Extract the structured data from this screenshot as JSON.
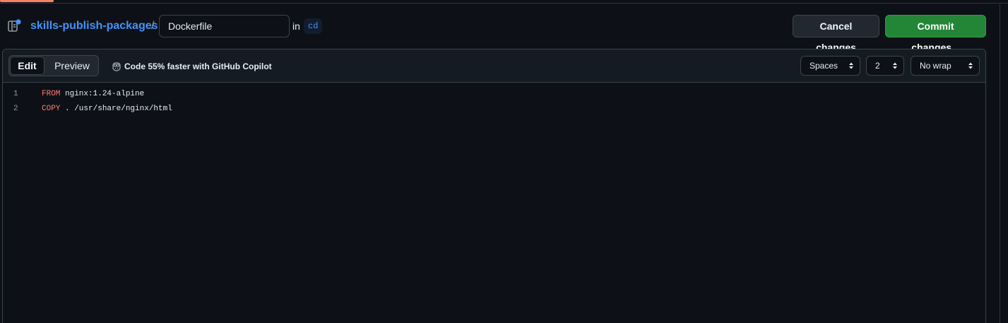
{
  "header": {
    "repo_name": "skills-publish-packages",
    "separator": "/",
    "filename_value": "Dockerfile",
    "in_label": "in",
    "branch": "cd",
    "cancel_label": "Cancel changes",
    "commit_label": "Commit changes..."
  },
  "toolbar": {
    "tabs": [
      {
        "label": "Edit",
        "selected": true
      },
      {
        "label": "Preview",
        "selected": false
      }
    ],
    "copilot_text": "Code 55% faster with GitHub Copilot",
    "indent_mode": "Spaces",
    "indent_size": "2",
    "wrap_mode": "No wrap"
  },
  "code": {
    "lines": [
      {
        "number": "1",
        "keyword": "FROM",
        "rest": " nginx:1.24-alpine"
      },
      {
        "number": "2",
        "keyword": "COPY",
        "rest": " . /usr/share/nginx/html"
      }
    ]
  },
  "colors": {
    "accent_link": "#4493f8",
    "commit_green": "#238636",
    "keyword": "#ff7b72",
    "background": "#0d1117"
  },
  "icons": {
    "repo": "repo-push-icon",
    "copilot": "copilot-icon",
    "select_arrows": "chevron-up-down-icon"
  }
}
